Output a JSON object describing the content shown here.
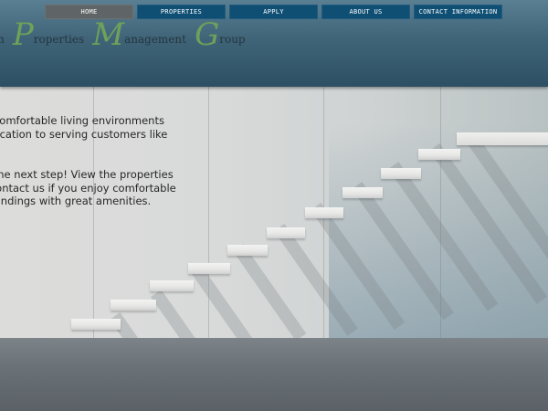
{
  "nav": {
    "items": [
      {
        "label": "HOME",
        "active": true
      },
      {
        "label": "PROPERTIES",
        "active": false
      },
      {
        "label": "APPLY",
        "active": false
      },
      {
        "label": "ABOUT US",
        "active": false
      },
      {
        "label": "CONTACT INFORMATION",
        "active": false
      }
    ]
  },
  "logo": {
    "words": [
      {
        "cap": "",
        "rest": "lon"
      },
      {
        "cap": "P",
        "rest": "roperties"
      },
      {
        "cap": "M",
        "rest": "anagement"
      },
      {
        "cap": "G",
        "rest": "roup"
      }
    ],
    "accent_color": "#6fa15a"
  },
  "hero": {
    "paragraph1": [
      "g comfortable living environments",
      "edication to serving customers like"
    ],
    "paragraph2": [
      "e the next step! View the properties",
      "l contact us if you enjoy comfortable",
      "roundings with great amenities."
    ]
  },
  "colors": {
    "header": "#3f6478",
    "nav_item": "#0f4f74",
    "nav_active": "#5f6466"
  }
}
